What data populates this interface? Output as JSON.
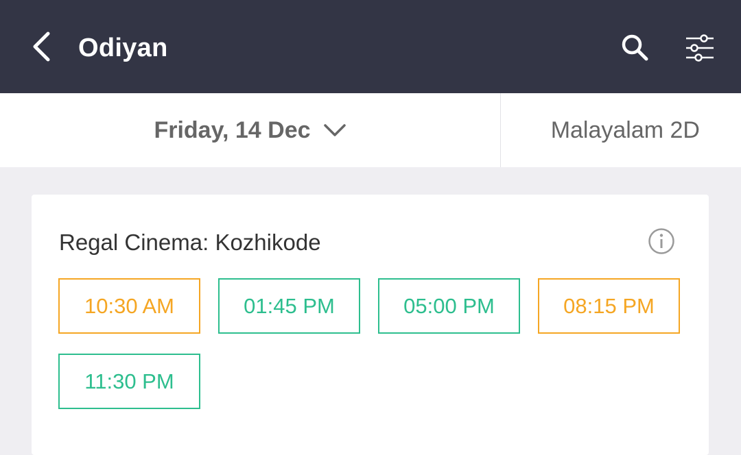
{
  "header": {
    "title": "Odiyan",
    "back_icon": "chevron-left-icon",
    "search_icon": "search-icon",
    "filter_icon": "sliders-icon",
    "background_color": "#333545"
  },
  "selectors": {
    "date_label": "Friday, 14 Dec",
    "date_dropdown_icon": "chevron-down-icon",
    "format_label": "Malayalam 2D"
  },
  "cinema": {
    "name": "Regal Cinema: Kozhikode",
    "info_icon": "info-icon",
    "showtimes": [
      {
        "time": "10:30 AM",
        "availability": "filling-fast",
        "color": "#f5a623"
      },
      {
        "time": "01:45 PM",
        "availability": "available",
        "color": "#2dbe8e"
      },
      {
        "time": "05:00 PM",
        "availability": "available",
        "color": "#2dbe8e"
      },
      {
        "time": "08:15 PM",
        "availability": "filling-fast",
        "color": "#f5a623"
      },
      {
        "time": "11:30 PM",
        "availability": "available",
        "color": "#2dbe8e"
      }
    ]
  }
}
